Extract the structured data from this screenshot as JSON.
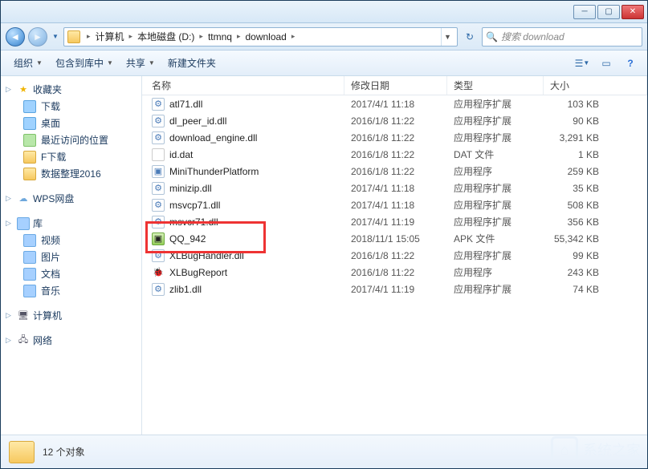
{
  "breadcrumb": [
    "计算机",
    "本地磁盘 (D:)",
    "ttmnq",
    "download"
  ],
  "search_placeholder": "搜索 download",
  "toolbar": {
    "organize": "组织",
    "include": "包含到库中",
    "share": "共享",
    "newfolder": "新建文件夹"
  },
  "columns": {
    "name": "名称",
    "date": "修改日期",
    "type": "类型",
    "size": "大小"
  },
  "nav": {
    "favorites": {
      "label": "收藏夹",
      "items": [
        "下载",
        "桌面",
        "最近访问的位置",
        "F下载",
        "数据整理2016"
      ]
    },
    "wps": {
      "label": "WPS网盘"
    },
    "libraries": {
      "label": "库",
      "items": [
        "视频",
        "图片",
        "文档",
        "音乐"
      ]
    },
    "computer": {
      "label": "计算机"
    },
    "network": {
      "label": "网络"
    }
  },
  "files": [
    {
      "name": "atl71.dll",
      "date": "2017/4/1 11:18",
      "type": "应用程序扩展",
      "size": "103 KB",
      "icon": "dll"
    },
    {
      "name": "dl_peer_id.dll",
      "date": "2016/1/8 11:22",
      "type": "应用程序扩展",
      "size": "90 KB",
      "icon": "dll"
    },
    {
      "name": "download_engine.dll",
      "date": "2016/1/8 11:22",
      "type": "应用程序扩展",
      "size": "3,291 KB",
      "icon": "dll"
    },
    {
      "name": "id.dat",
      "date": "2016/1/8 11:22",
      "type": "DAT 文件",
      "size": "1 KB",
      "icon": "dat"
    },
    {
      "name": "MiniThunderPlatform",
      "date": "2016/1/8 11:22",
      "type": "应用程序",
      "size": "259 KB",
      "icon": "exe"
    },
    {
      "name": "minizip.dll",
      "date": "2017/4/1 11:18",
      "type": "应用程序扩展",
      "size": "35 KB",
      "icon": "dll"
    },
    {
      "name": "msvcp71.dll",
      "date": "2017/4/1 11:18",
      "type": "应用程序扩展",
      "size": "508 KB",
      "icon": "dll"
    },
    {
      "name": "msvcr71.dll",
      "date": "2017/4/1 11:19",
      "type": "应用程序扩展",
      "size": "356 KB",
      "icon": "dll"
    },
    {
      "name": "QQ_942",
      "date": "2018/11/1 15:05",
      "type": "APK 文件",
      "size": "55,342 KB",
      "icon": "apk",
      "highlight": true
    },
    {
      "name": "XLBugHandler.dll",
      "date": "2016/1/8 11:22",
      "type": "应用程序扩展",
      "size": "99 KB",
      "icon": "dll"
    },
    {
      "name": "XLBugReport",
      "date": "2016/1/8 11:22",
      "type": "应用程序",
      "size": "243 KB",
      "icon": "bug"
    },
    {
      "name": "zlib1.dll",
      "date": "2017/4/1 11:19",
      "type": "应用程序扩展",
      "size": "74 KB",
      "icon": "dll"
    }
  ],
  "status": {
    "count": "12 个对象"
  },
  "watermark": "系统之家"
}
